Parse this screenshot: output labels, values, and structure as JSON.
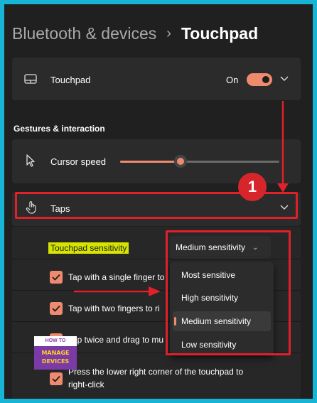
{
  "breadcrumb": {
    "parent": "Bluetooth & devices",
    "separator": "›",
    "current": "Touchpad"
  },
  "touchpad_row": {
    "label": "Touchpad",
    "state": "On",
    "icon": "touchpad-icon"
  },
  "section": {
    "title": "Gestures & interaction"
  },
  "cursor_row": {
    "label": "Cursor speed",
    "icon": "cursor-icon",
    "slider_value_fraction": 0.38
  },
  "taps_row": {
    "label": "Taps",
    "icon": "tap-hand-icon"
  },
  "annotation": {
    "step_number": "1"
  },
  "sensitivity": {
    "label": "Touchpad sensitivity",
    "selected": "Medium sensitivity",
    "options": [
      "Most sensitive",
      "High sensitivity",
      "Medium sensitivity",
      "Low sensitivity"
    ]
  },
  "checkboxes": [
    {
      "text": "Tap with a single finger to",
      "checked": true
    },
    {
      "text": "Tap with two fingers to ri",
      "checked": true
    },
    {
      "text": "Tap twice and drag to mu",
      "checked": true
    },
    {
      "line1": "Press the lower right corner of the touchpad to",
      "line2": "right-click",
      "checked": true
    }
  ],
  "logo": {
    "line1": "HOW TO",
    "line2": "MANAGE",
    "line3": "DEVICES"
  },
  "colors": {
    "accent": "#ee8b6e",
    "highlight_box": "#e0202a",
    "marker_yellow": "#d6e400",
    "window_bg": "#202020",
    "card_bg": "#2b2b2b",
    "frame_border": "#17b4d6"
  }
}
